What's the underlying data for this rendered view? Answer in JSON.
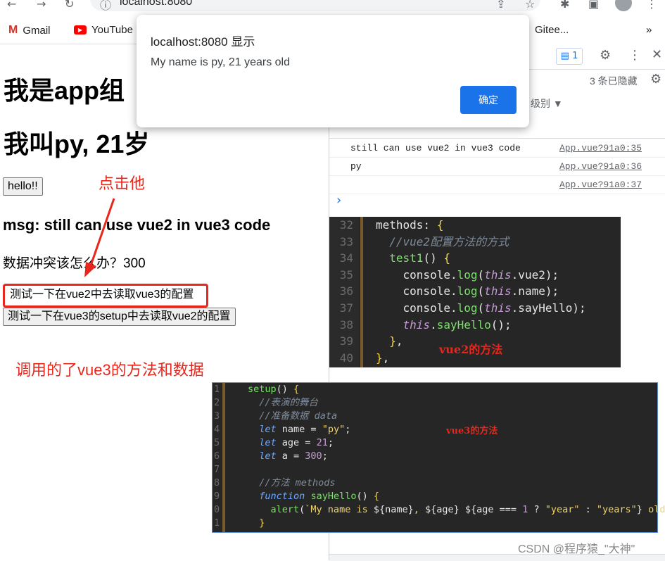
{
  "browser": {
    "address": "localhost:8080",
    "bookmarks": [
      "Gmail",
      "YouTube",
      "Gitee..."
    ],
    "overflow": "»"
  },
  "page": {
    "heading1": "我是app组",
    "heading2": "我叫py, 21岁",
    "hello_button": "hello!!",
    "msg": "msg: still can use vue2 in vue3 code",
    "conflict": "数据冲突该怎么办？300",
    "btn_vue2_read_vue3": "测试一下在vue2中去读取vue3的配置",
    "btn_vue3_read_vue2": "测试一下在vue3的setup中去读取vue2的配置"
  },
  "annotations": {
    "click_him": "点击他",
    "called_vue3": "调用的了vue3的方法和数据",
    "vue2_method": "vue2的方法",
    "vue3_method": "vue3的方法",
    "accent": "#e8261b"
  },
  "dialog": {
    "title": "localhost:8080 显示",
    "message": "My name is py, 21 years old",
    "ok": "确定"
  },
  "devtools": {
    "issues_count": "1",
    "hidden": "3 条已隐藏",
    "level": "级别 ▼",
    "logs": [
      {
        "text": "still can use vue2 in vue3 code",
        "source": "App.vue?91a0:35"
      },
      {
        "text": "py",
        "source": "App.vue?91a0:36"
      },
      {
        "text": "",
        "source": "App.vue?91a0:37"
      }
    ],
    "prompt": "›"
  },
  "code_vue2": {
    "line_numbers": [
      "32",
      "33",
      "34",
      "35",
      "36",
      "37",
      "38",
      "39",
      "40"
    ]
  },
  "code_vue3": {
    "line_numbers": [
      "1",
      "2",
      "3",
      "4",
      "5",
      "6",
      "7",
      "8",
      "9",
      "0",
      "1"
    ]
  },
  "watermark": "CSDN @程序猿_\"大神\""
}
